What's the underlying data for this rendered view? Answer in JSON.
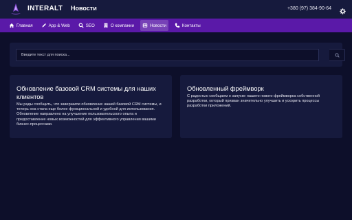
{
  "header": {
    "brand": "INTERALT",
    "page_title": "Новости",
    "phone": "+380 (97) 384-90-64"
  },
  "nav": {
    "items": [
      {
        "label": "Главная",
        "icon": "home-icon"
      },
      {
        "label": "App & Web",
        "icon": "app-web-icon"
      },
      {
        "label": "SEO",
        "icon": "seo-icon"
      },
      {
        "label": "О компании",
        "icon": "building-icon"
      },
      {
        "label": "Новости",
        "icon": "news-icon",
        "active": true
      },
      {
        "label": "Контакты",
        "icon": "phone-icon"
      }
    ]
  },
  "search": {
    "placeholder": "Введите текст для поиска..."
  },
  "news": [
    {
      "title": "Обновление базовой CRM системы для наших клиентов",
      "text": "Мы рады сообщить, что завершили обновление нашей базовой CRM системы, и теперь она стала еще более функциональной и удобной для использования. Обновление направлено на улучшение пользовательского опыта и предоставление новых возможностей для эффективного управления вашими бизнес-процессами."
    },
    {
      "title": "Обновленный фреймворк",
      "text": "С радостью сообщаем о запуске нашего нового фреймворка собственной разработки, который призван значительно улучшить и ускорить процессы разработки приложений."
    }
  ],
  "colors": {
    "background": "#0d0f2a",
    "panel": "#161a3d",
    "nav": "#5a19a8",
    "accent": "#8a4dd6"
  }
}
